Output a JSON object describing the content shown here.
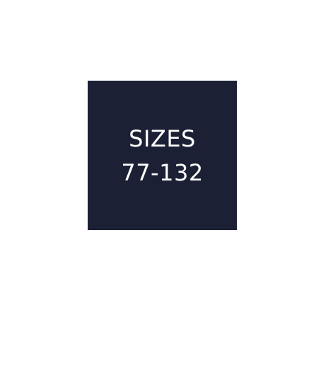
{
  "tile": {
    "background_color": "#1c2035",
    "text_color": "#ffffff",
    "heading": "SIZES",
    "range": "77-132"
  }
}
